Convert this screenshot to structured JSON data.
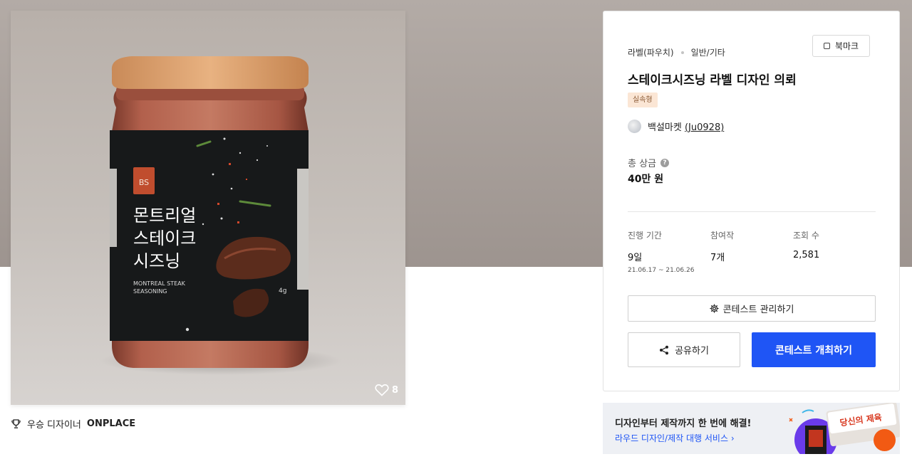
{
  "product_image": {
    "label_title_lines": [
      "몬트리얼",
      "스테이크",
      "시즈닝"
    ],
    "label_subtitle_lines": [
      "MONTREAL STEAK",
      "SEASONING"
    ],
    "label_weight": "4g",
    "logo_text": "BS",
    "likes": "8"
  },
  "winner": {
    "prefix": "우승 디자이너",
    "name": "ONPLACE"
  },
  "contest": {
    "category": "라벨(파우치)",
    "subcategory": "일반/기타",
    "bookmark_label": "북마크",
    "title": "스테이크시즈닝 라벨 디자인 의뢰",
    "tag": "실속형",
    "author_name": "백설마켓",
    "author_handle": "(Ju0928)",
    "prize_label": "총 상금",
    "prize_value": "40만 원",
    "stats": [
      {
        "label": "진행 기간",
        "value": "9일",
        "sub": "21.06.17  ~  21.06.26"
      },
      {
        "label": "참여작",
        "value": "7개",
        "sub": ""
      },
      {
        "label": "조회 수",
        "value": "2,581",
        "sub": ""
      }
    ],
    "manage_label": "콘테스트 관리하기",
    "share_label": "공유하기",
    "host_label": "콘테스트 개최하기"
  },
  "promo": {
    "headline": "디자인부터 제작까지 한 번에 해결!",
    "link": "라우드 디자인/제작 대행 서비스 ›",
    "badge_text": "당신의 제육"
  },
  "colors": {
    "primary": "#1f55f5",
    "tag_bg": "#fbe6d5",
    "accent_orange": "#f25a13"
  }
}
